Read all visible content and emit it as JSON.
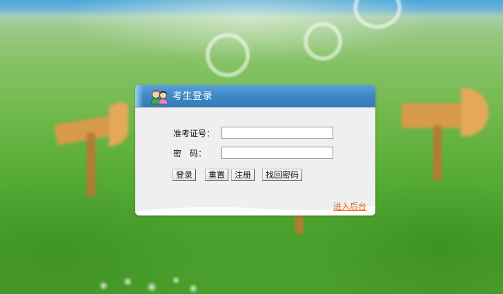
{
  "login": {
    "title": "考生登录",
    "exam_id_label": "准考证号：",
    "exam_id_value": "",
    "password_label": "密　码：",
    "password_value": "",
    "buttons": {
      "login": "登录",
      "reset": "重置",
      "register": "注册",
      "recover": "找回密码"
    },
    "admin_link": "进入后台"
  },
  "icons": {
    "header_icon": "two-users-icon"
  },
  "colors": {
    "header_blue": "#3d86c4",
    "panel_bg": "#efefef",
    "link_orange": "#e2620a"
  }
}
